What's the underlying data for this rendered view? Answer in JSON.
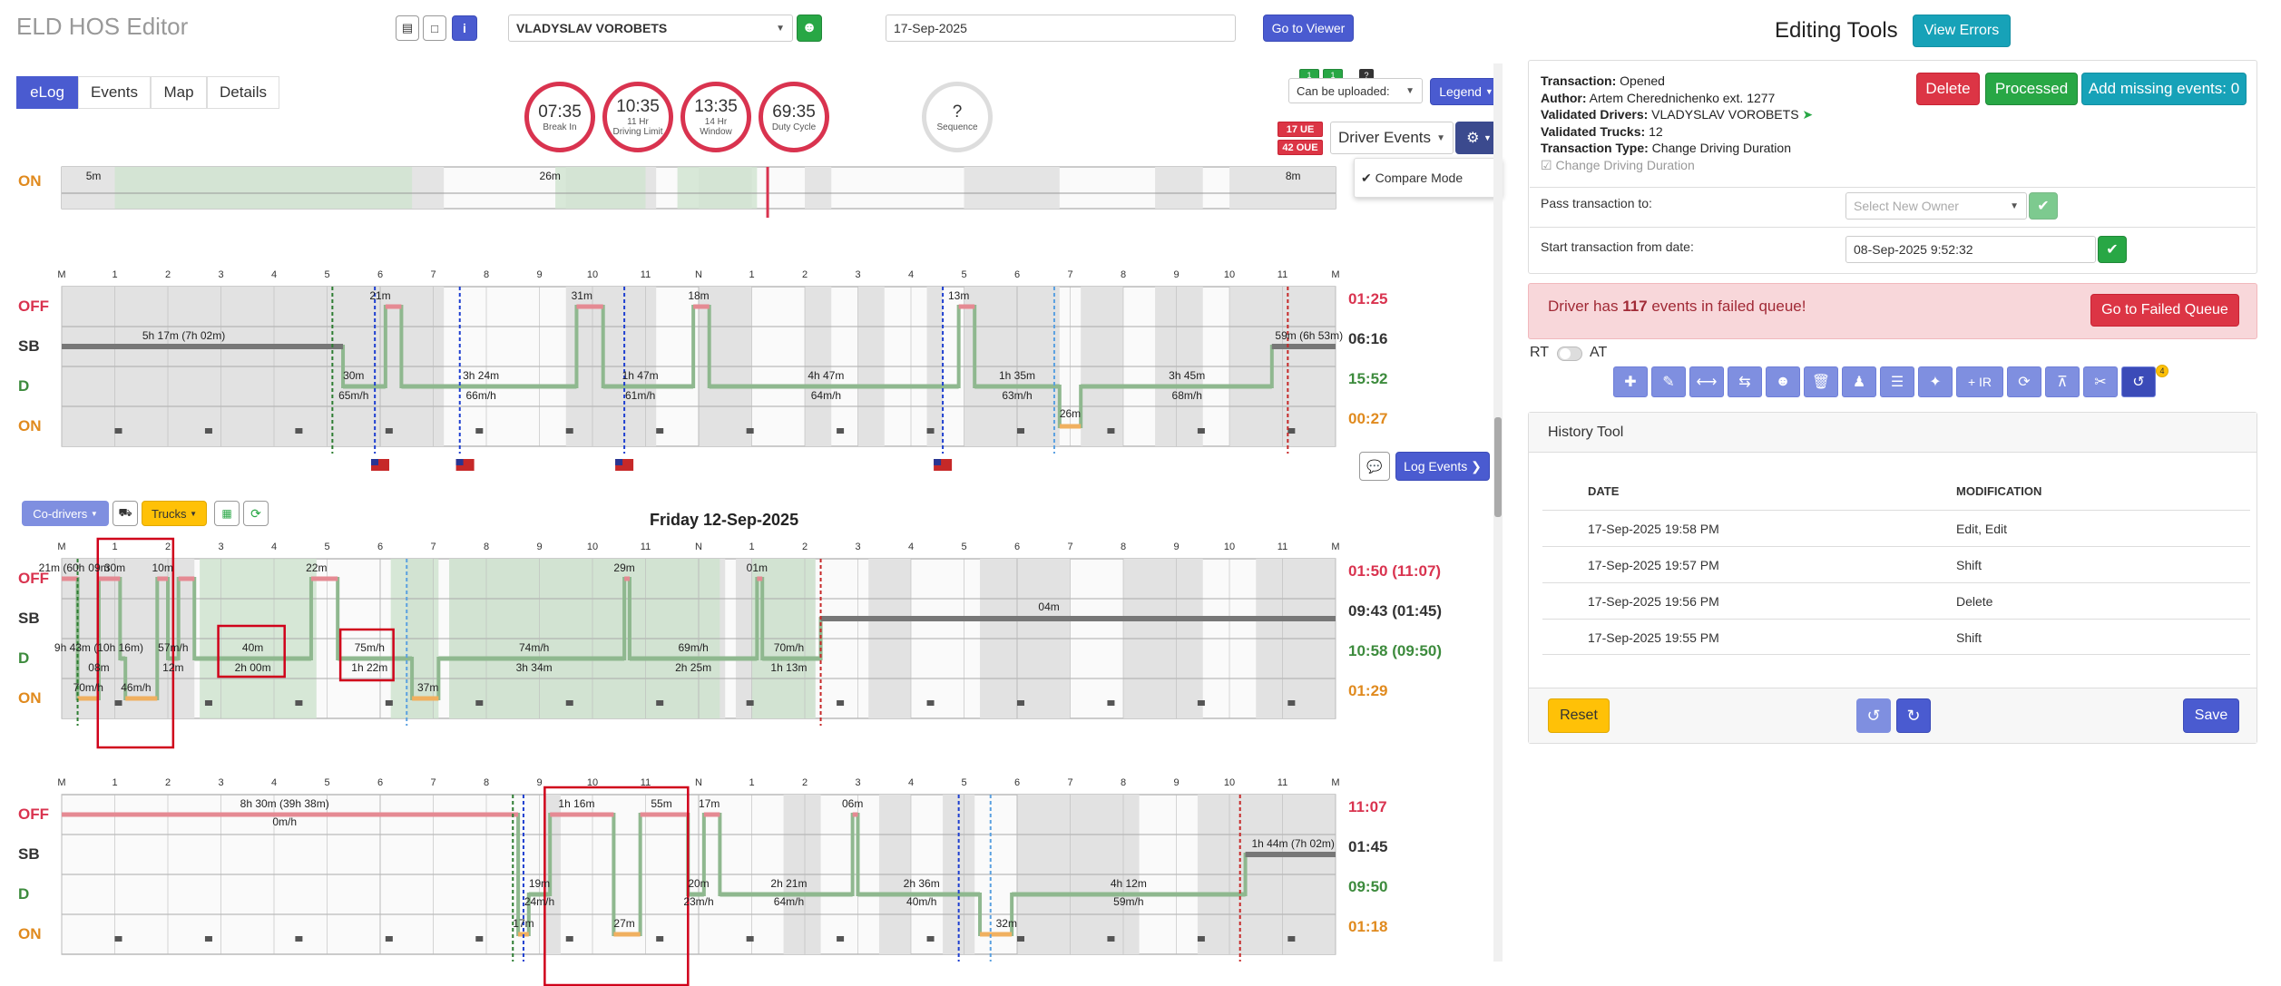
{
  "app": {
    "title": "ELD HOS Editor",
    "driver": "VLADYSLAV VOROBETS",
    "date": "17-Sep-2025",
    "goto_viewer": "Go to Viewer"
  },
  "tabs": [
    "eLog",
    "Events",
    "Map",
    "Details"
  ],
  "gauges": [
    {
      "value": "07:35",
      "label": "Break In"
    },
    {
      "value": "10:35",
      "label": "11 Hr Driving Limit"
    },
    {
      "value": "13:35",
      "label": "14 Hr Window"
    },
    {
      "value": "69:35",
      "label": "Duty Cycle"
    },
    {
      "value": "?",
      "label": "Sequence"
    }
  ],
  "controls": {
    "can_be_uploaded": "Can be uploaded:",
    "legend": "Legend",
    "driver_events": "Driver Events",
    "compare_mode": "Compare Mode",
    "badge_ue": "17 UE",
    "badge_oue": "42 OUE",
    "badge_a": "1",
    "badge_b": "1",
    "badge_q": "?"
  },
  "status_labels": [
    "OFF",
    "SB",
    "D",
    "ON"
  ],
  "hours": [
    "M",
    "1",
    "2",
    "3",
    "4",
    "5",
    "6",
    "7",
    "8",
    "9",
    "10",
    "11",
    "N",
    "1",
    "2",
    "3",
    "4",
    "5",
    "6",
    "7",
    "8",
    "9",
    "10",
    "11",
    "M"
  ],
  "grid0": {
    "totals": [
      "01:25",
      "06:16",
      "15:52",
      "00:27"
    ]
  },
  "grid1": {
    "title": "Friday 12-Sep-2025",
    "totals": [
      "01:50 (11:07)",
      "09:43 (01:45)",
      "10:58 (09:50)",
      "01:29"
    ]
  },
  "grid2": {
    "totals": [
      "11:07",
      "01:45",
      "09:50",
      "01:18"
    ]
  },
  "grid_labels": {
    "g0": [
      "5m",
      "26m",
      "8m",
      "21m",
      "31m",
      "18m",
      "13m",
      "5h 17m (7h 02m)",
      "30m",
      "65m/h",
      "3h 24m",
      "66m/h",
      "1h 47m",
      "61m/h",
      "4h 47m",
      "64m/h",
      "1h 35m",
      "63m/h",
      "3h 45m",
      "68m/h",
      "26m",
      "59m (6h 53m)"
    ],
    "g1": [
      "21m (60h",
      "09m",
      "30m",
      "10m",
      "22m",
      "29m",
      "01m",
      "04m",
      "9h 43m (10h 16m)",
      "08m",
      "57m/h",
      "12m",
      "46m/h",
      "40m",
      "2h 00m",
      "75m/h",
      "1h 22m",
      "74m/h",
      "3h 34m",
      "69m/h",
      "2h 25m",
      "70m/h",
      "1h 13m",
      "70m/h",
      "37m",
      "30m"
    ],
    "g2": [
      "8h 30m (39h 38m)",
      "0m/h",
      "1h 16m",
      "55m",
      "17m",
      "06m",
      "19m",
      "24m/h",
      "27m",
      "20m",
      "23m/h",
      "2h 21m",
      "64m/h",
      "2h 36m",
      "40m/h",
      "32m",
      "4h 12m",
      "59m/h",
      "1h 44m (7h 02m)",
      "17m"
    ]
  },
  "buttons": {
    "co_drivers": "Co-drivers",
    "trucks": "Trucks",
    "log_events": "Log Events"
  },
  "editing": {
    "title": "Editing Tools",
    "view_errors": "View Errors",
    "transaction": "Opened",
    "author": "Artem Cherednichenko ext. 1277",
    "validated_drivers": "VLADYSLAV VOROBETS",
    "validated_trucks": "12",
    "transaction_type": "Change Driving Duration",
    "change_driving": "Change Driving Duration",
    "lbl_transaction": "Transaction:",
    "lbl_author": "Author:",
    "lbl_drivers": "Validated Drivers:",
    "lbl_trucks": "Validated Trucks:",
    "lbl_type": "Transaction Type:",
    "delete": "Delete",
    "processed": "Processed",
    "add_missing": "Add missing events: 0",
    "pass_to": "Pass transaction to:",
    "select_owner": "Select New Owner",
    "start_from": "Start transaction from date:",
    "start_date": "08-Sep-2025 9:52:32",
    "failed_pre": "Driver has ",
    "failed_count": "117",
    "failed_post": " events in failed queue!",
    "go_failed": "Go to Failed Queue",
    "rt": "RT",
    "at": "AT",
    "ir": "+ IR",
    "tool_badge": "4"
  },
  "history": {
    "title": "History Tool",
    "headers": [
      "DATE",
      "MODIFICATION"
    ],
    "rows": [
      {
        "date": "17-Sep-2025 19:58 PM",
        "mod": "Edit, Edit"
      },
      {
        "date": "17-Sep-2025 19:57 PM",
        "mod": "Shift"
      },
      {
        "date": "17-Sep-2025 19:56 PM",
        "mod": "Delete"
      },
      {
        "date": "17-Sep-2025 19:55 PM",
        "mod": "Shift"
      }
    ],
    "reset": "Reset",
    "save": "Save"
  }
}
